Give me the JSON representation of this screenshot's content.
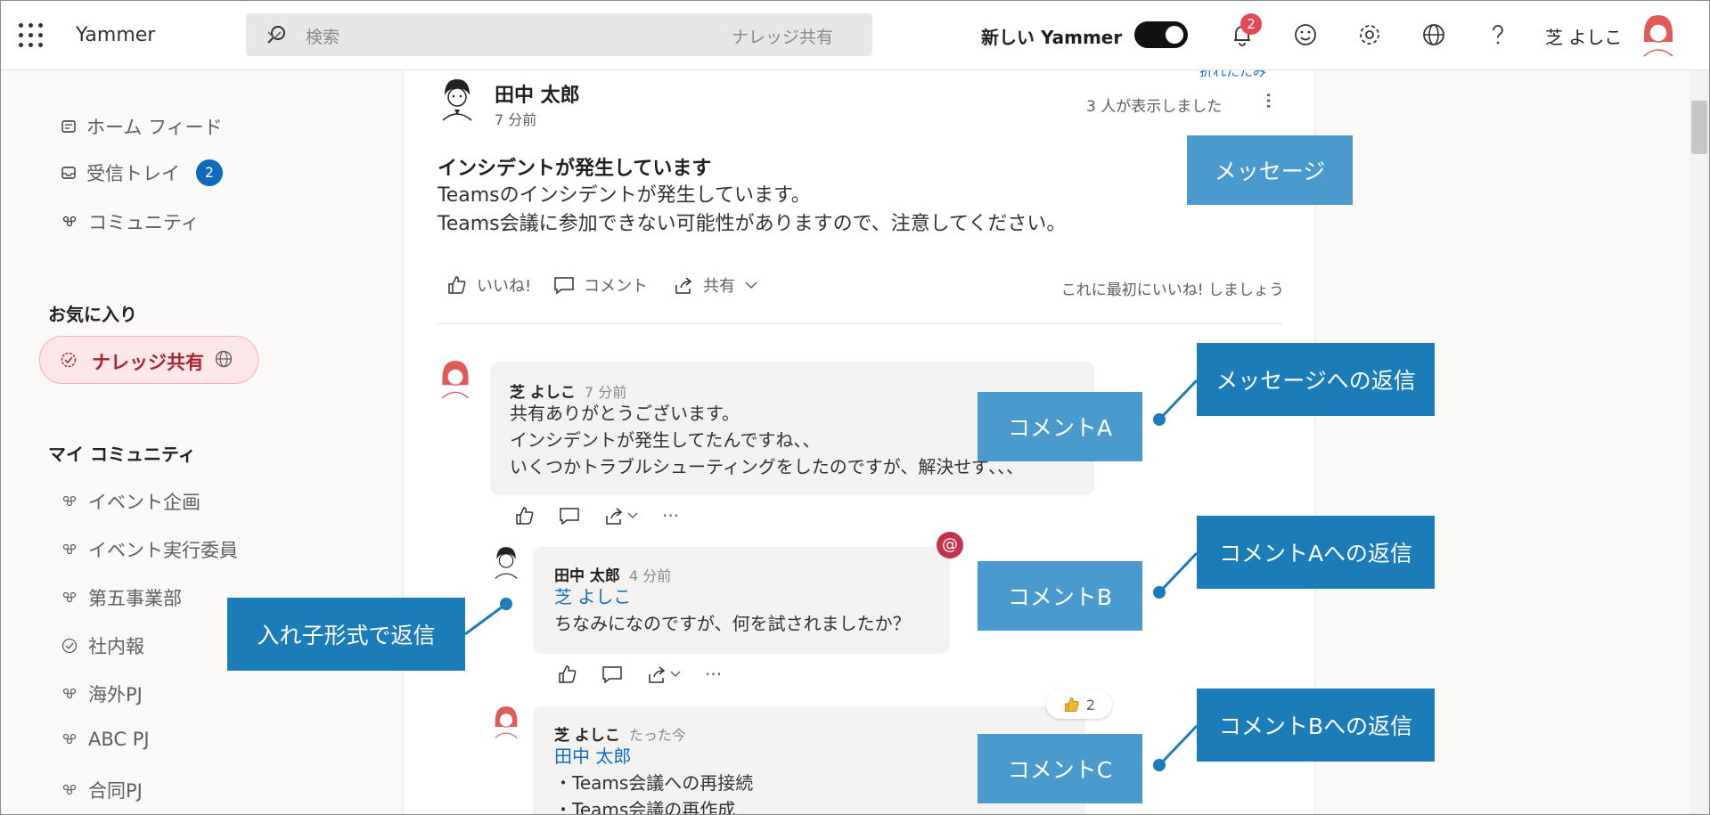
{
  "header": {
    "app_name": "Yammer",
    "search_placeholder": "検索",
    "search_scope": "ナレッジ共有",
    "new_yammer_label": "新しい Yammer",
    "notification_count": "2",
    "user_name": "芝 よしこ"
  },
  "sidebar": {
    "nav": [
      {
        "label": "ホーム フィード"
      },
      {
        "label": "受信トレイ",
        "badge": "2"
      },
      {
        "label": "コミュニティ"
      }
    ],
    "favorites_title": "お気に入り",
    "favorite_item": "ナレッジ共有",
    "my_communities_title": "マイ コミュニティ",
    "communities": [
      "イベント企画",
      "イベント実行委員",
      "第五事業部",
      "社内報",
      "海外PJ",
      "ABC PJ",
      "合同PJ"
    ]
  },
  "post": {
    "cut_text": "折れたたみ",
    "author": "田中 太郎",
    "time": "7 分前",
    "views": "3 人が表示しました",
    "title": "インシデントが発生しています",
    "body": [
      "Teamsのインシデントが発生しています。",
      "Teams会議に参加できない可能性がありますので、注意してください。"
    ],
    "actions": {
      "like": "いいね!",
      "comment": "コメント",
      "share": "共有"
    },
    "first_like": "これに最初にいいね! しましょう"
  },
  "comments": {
    "a": {
      "name": "芝 よしこ",
      "time": "7 分前",
      "lines": [
        "共有ありがとうございます。",
        "インシデントが発生してたんですね、、",
        "いくつかトラブルシューティングをしたのですが、解決せず、、、"
      ]
    },
    "b": {
      "name": "田中 太郎",
      "time": "4 分前",
      "mention": "芝 よしこ",
      "lines": [
        "ちなみになのですが、何を試されましたか？"
      ]
    },
    "c": {
      "name": "芝 よしこ",
      "time": "たった今",
      "mention": "田中 太郎",
      "lines": [
        "・Teams会議への再接続",
        "・Teams会議の再作成"
      ],
      "reaction_count": "2"
    }
  },
  "badges": {
    "mention": "@"
  },
  "callouts": {
    "message": "メッセージ",
    "comment_a": "コメントA",
    "comment_b": "コメントB",
    "comment_c": "コメントC",
    "reply_message": "メッセージへの返信",
    "reply_a": "コメントAへの返信",
    "reply_b": "コメントBへの返信",
    "nested": "入れ子形式で返信"
  },
  "colors": {
    "accent": "#0f6cbd",
    "callout_light": "#4a9acd",
    "callout_dark": "#1c7cb8",
    "favorite_bg": "#fde7e9"
  }
}
